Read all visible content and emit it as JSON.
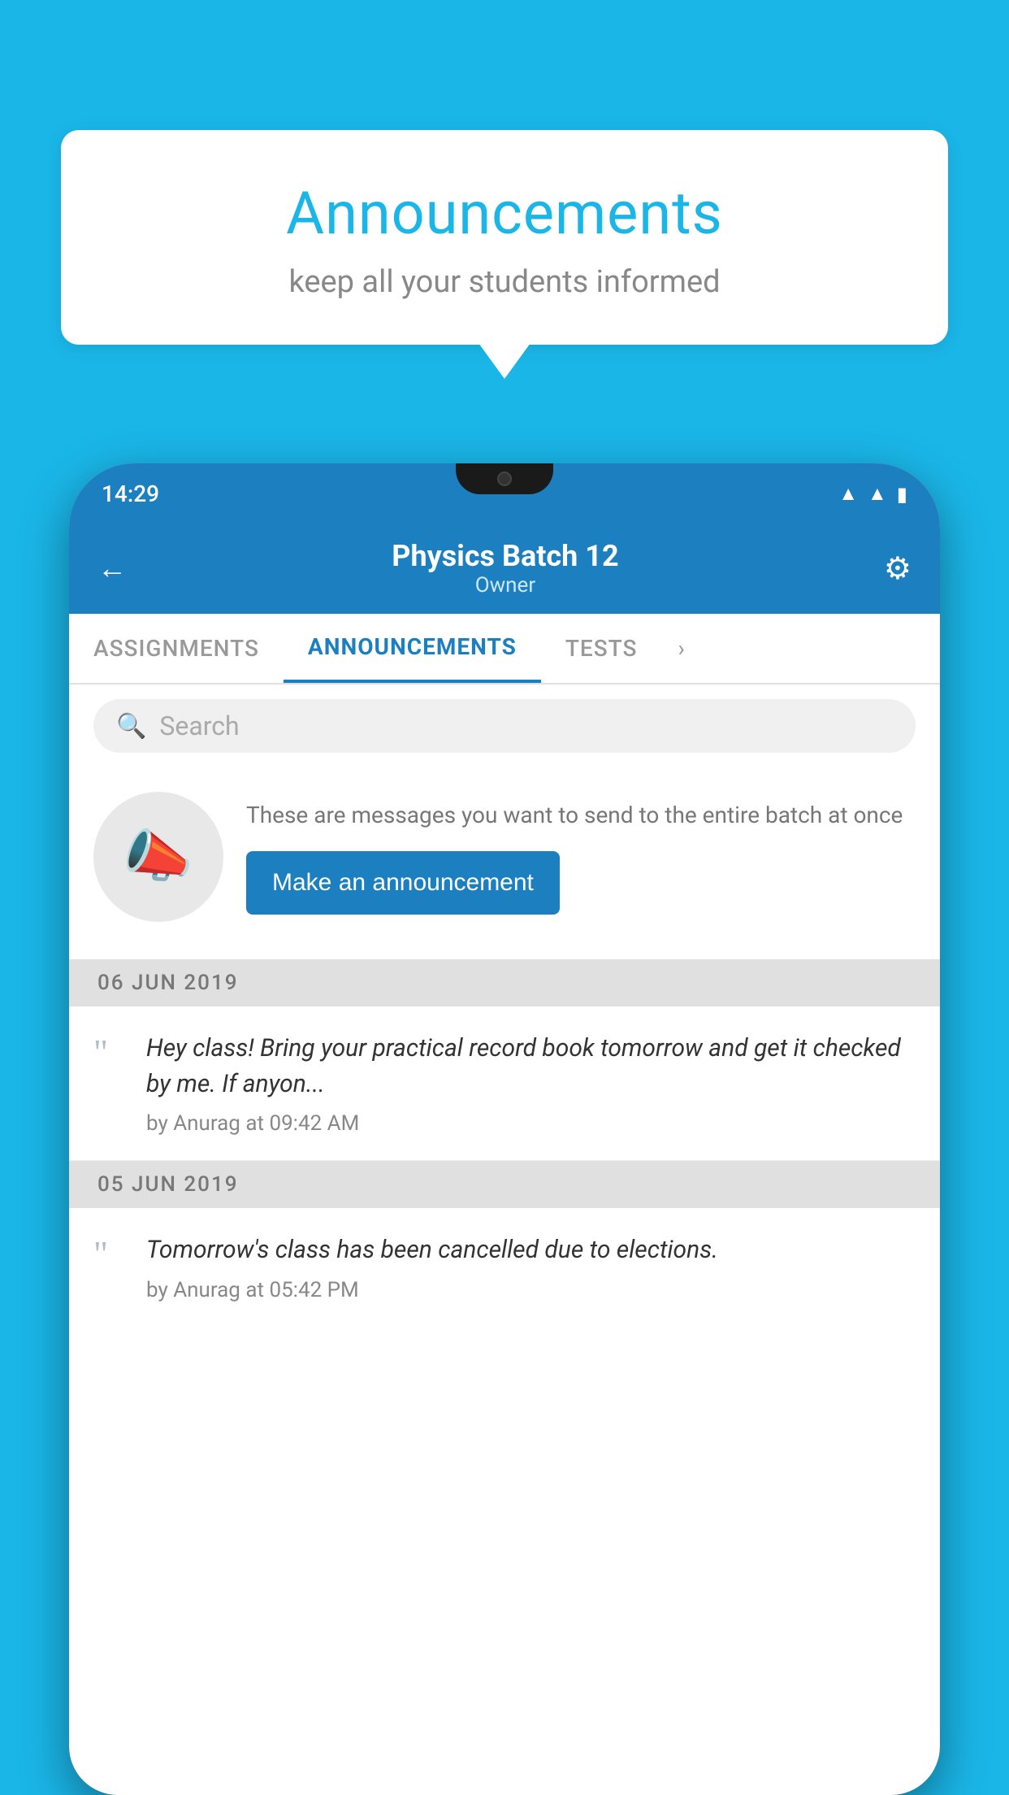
{
  "bubble": {
    "title": "Announcements",
    "subtitle": "keep all your students informed"
  },
  "status_bar": {
    "time": "14:29",
    "icons": [
      "wifi",
      "signal",
      "battery"
    ]
  },
  "header": {
    "title": "Physics Batch 12",
    "subtitle": "Owner",
    "back_label": "←",
    "gear_label": "⚙"
  },
  "tabs": [
    {
      "label": "ASSIGNMENTS",
      "active": false
    },
    {
      "label": "ANNOUNCEMENTS",
      "active": true
    },
    {
      "label": "TESTS",
      "active": false
    }
  ],
  "search": {
    "placeholder": "Search"
  },
  "promo": {
    "description": "These are messages you want to send to the entire batch at once",
    "button_label": "Make an announcement"
  },
  "announcements": [
    {
      "date": "06  JUN  2019",
      "text": "Hey class! Bring your practical record book tomorrow and get it checked by me. If anyon...",
      "meta": "by Anurag at 09:42 AM"
    },
    {
      "date": "05  JUN  2019",
      "text": "Tomorrow's class has been cancelled due to elections.",
      "meta": "by Anurag at 05:42 PM"
    }
  ]
}
